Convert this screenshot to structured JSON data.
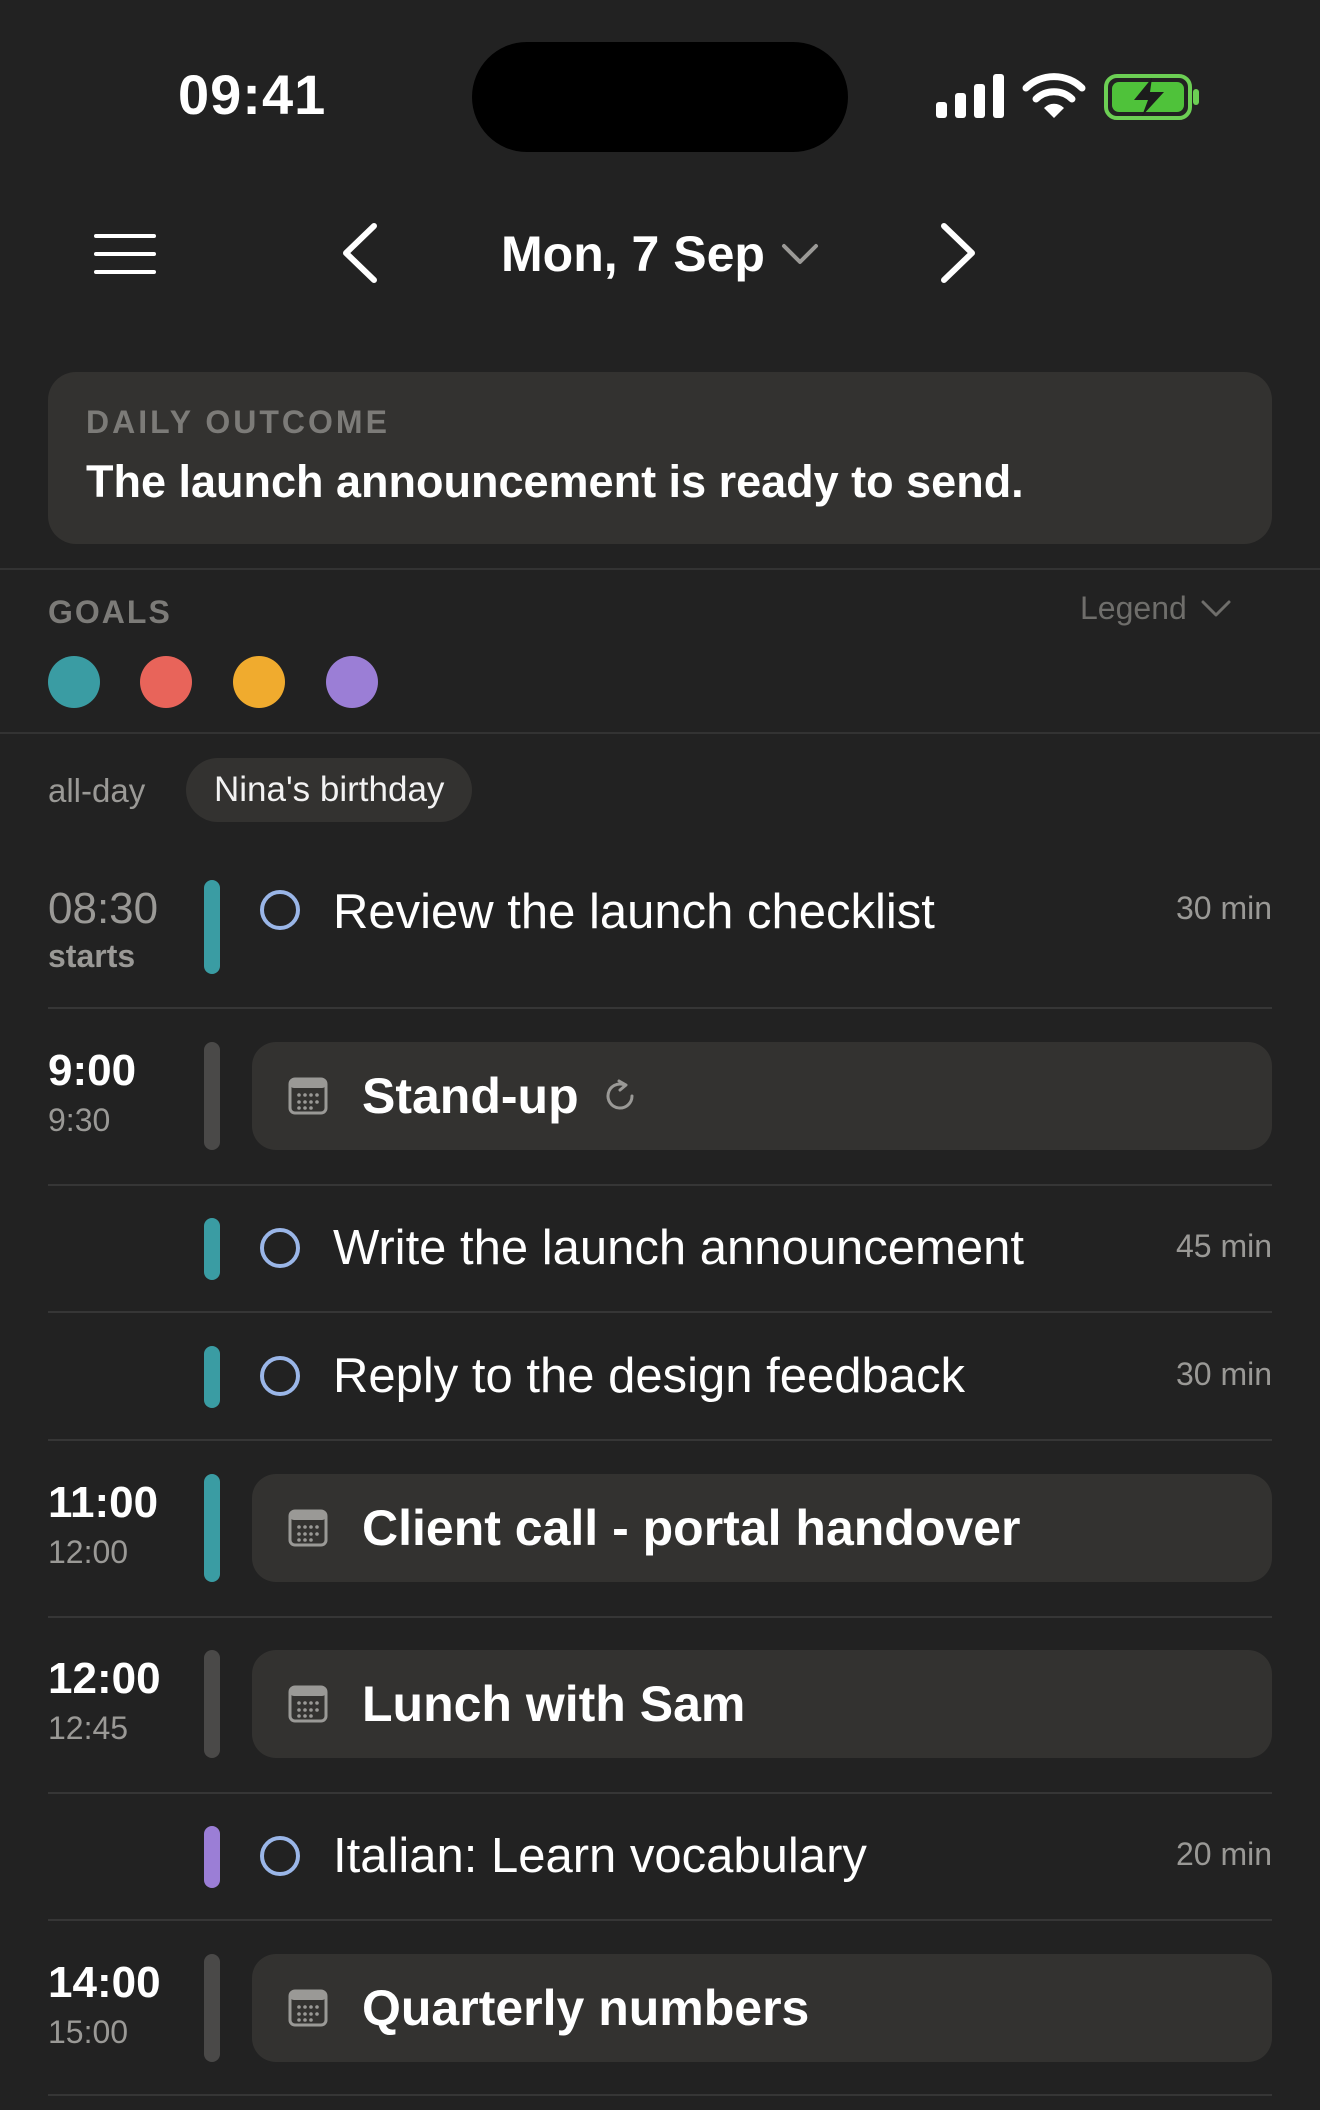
{
  "status_bar": {
    "time": "09:41"
  },
  "header": {
    "date": "Mon, 7 Sep"
  },
  "outcome": {
    "label": "DAILY OUTCOME",
    "text": "The launch announcement is ready to send."
  },
  "goals": {
    "label": "GOALS",
    "legend_label": "Legend",
    "colors": [
      "#3a9ca3",
      "#e8645a",
      "#f0ab2e",
      "#9b7ed6"
    ]
  },
  "all_day": {
    "label": "all-day",
    "event": "Nina's birthday"
  },
  "colors": {
    "teal": "#3a9ca3",
    "purple": "#9b7ed6",
    "neutral": "#4a4948",
    "task_circle": "#9ab6e8"
  },
  "agenda": {
    "task1": {
      "start": "08:30",
      "sub": "starts",
      "title": "Review the launch checklist",
      "duration": "30 min"
    },
    "event1": {
      "start": "9:00",
      "end": "9:30",
      "title": "Stand-up"
    },
    "task2": {
      "title": "Write the launch announcement",
      "duration": "45 min"
    },
    "task3": {
      "title": "Reply to the design feedback",
      "duration": "30 min"
    },
    "event2": {
      "start": "11:00",
      "end": "12:00",
      "title": "Client call - portal handover"
    },
    "event3": {
      "start": "12:00",
      "end": "12:45",
      "title": "Lunch with Sam"
    },
    "task4": {
      "title": "Italian: Learn vocabulary",
      "duration": "20 min"
    },
    "event4": {
      "start": "14:00",
      "end": "15:00",
      "title": "Quarterly numbers"
    }
  },
  "icons": {
    "menu": "hamburger-icon",
    "prev": "chevron-left-icon",
    "next": "chevron-right-icon",
    "calendar": "calendar-icon",
    "repeat": "repeat-icon"
  }
}
